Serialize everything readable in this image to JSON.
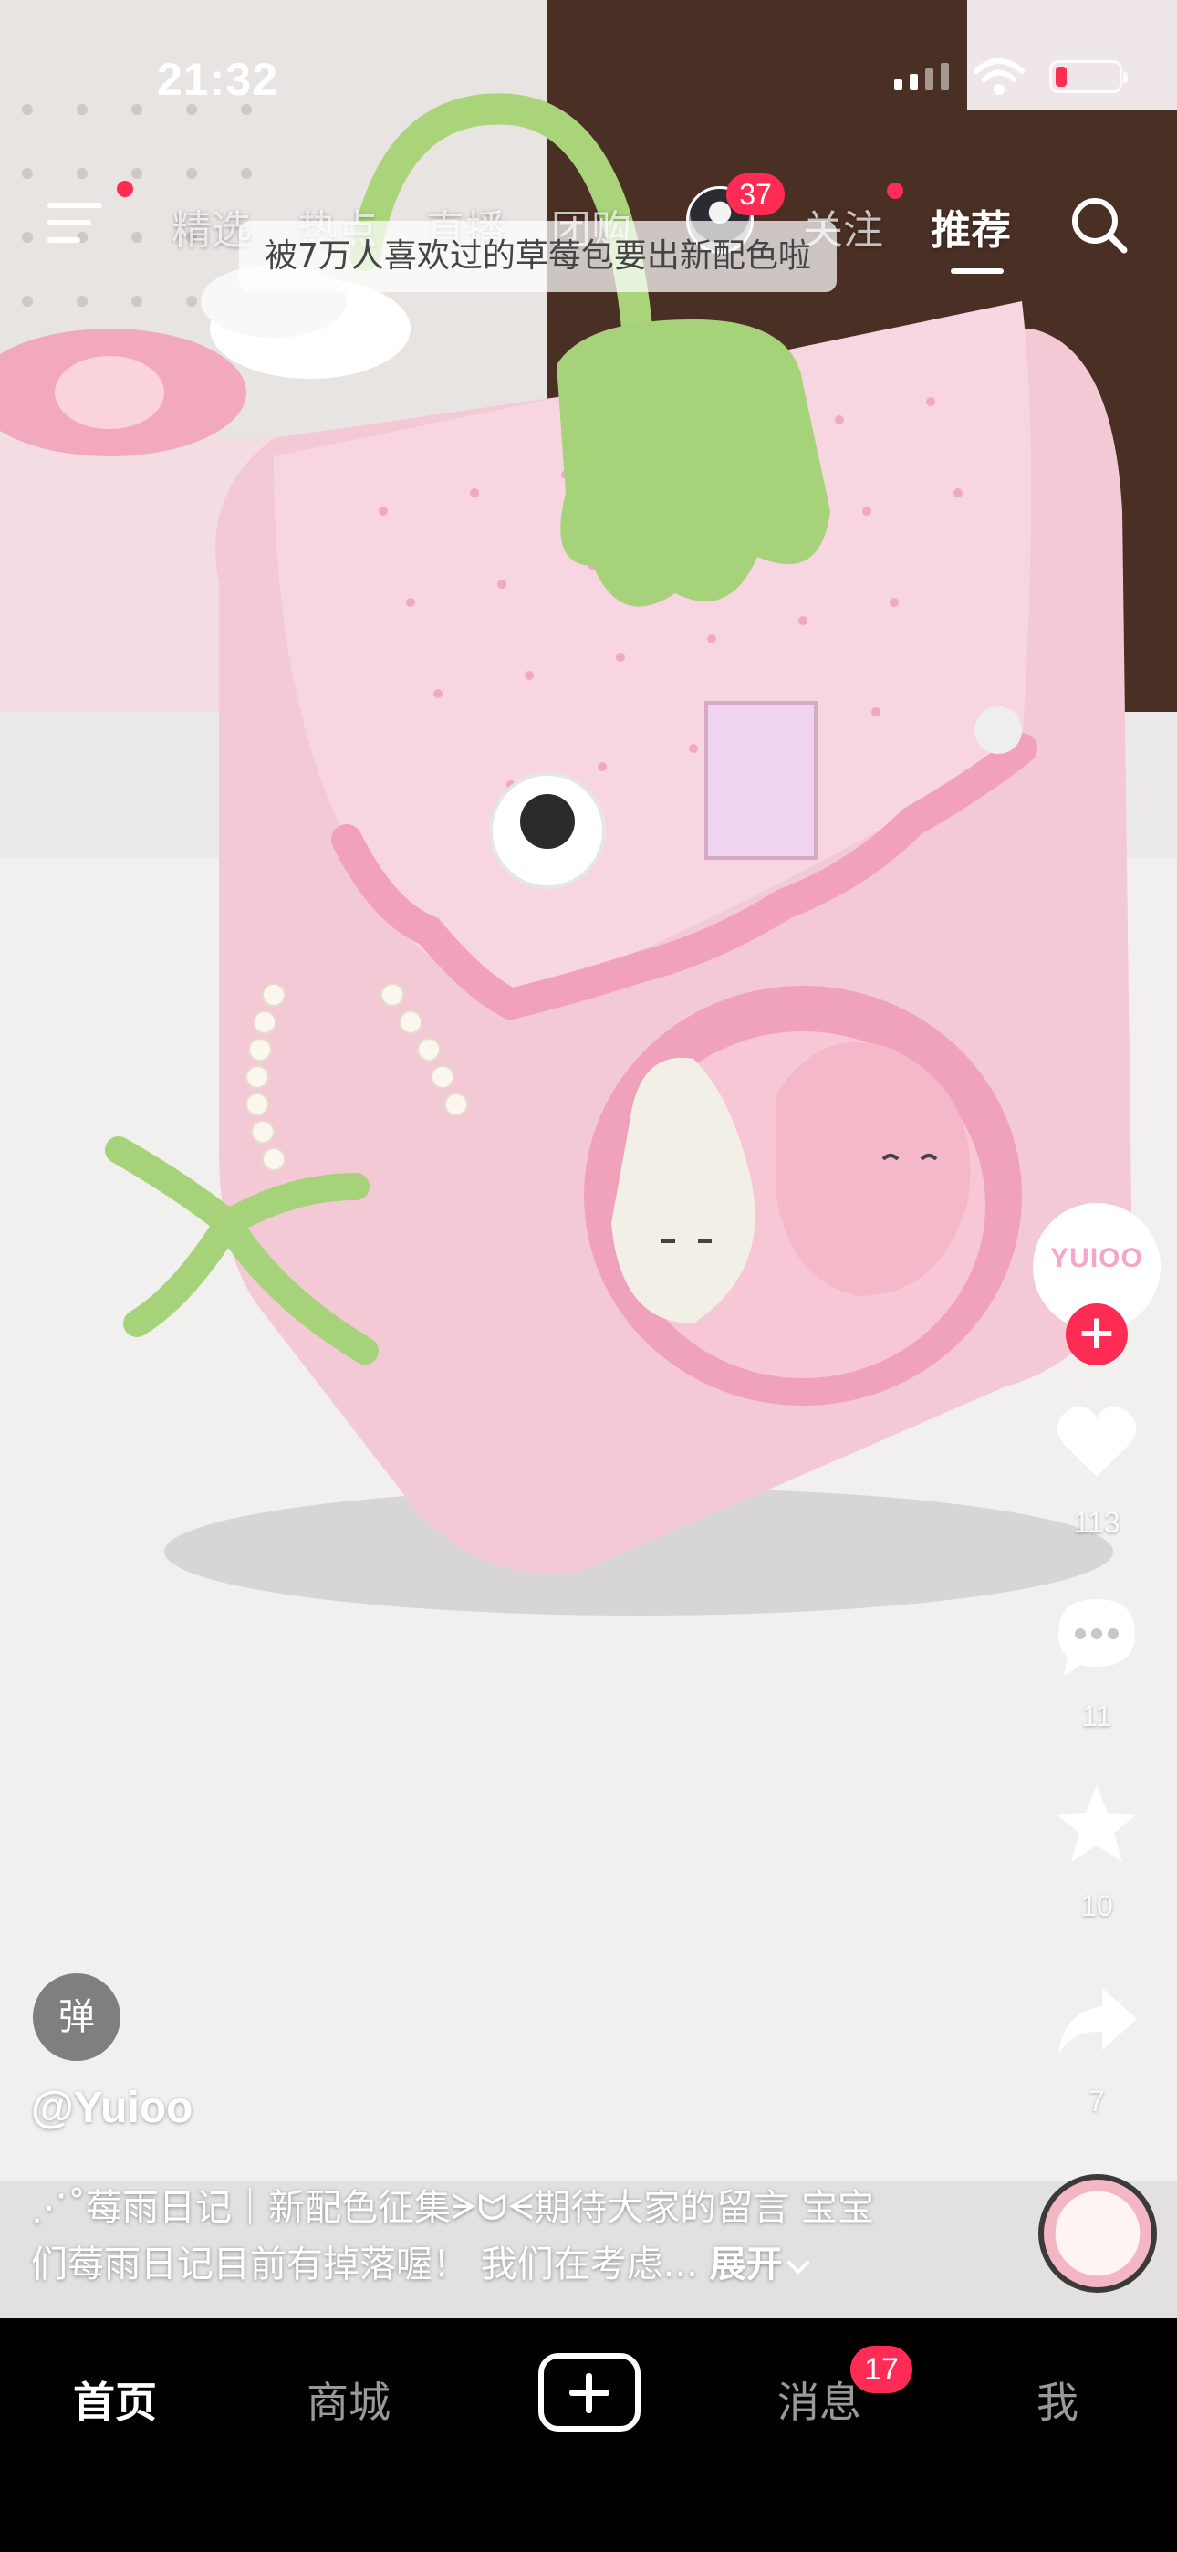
{
  "status_bar": {
    "time": "21:32",
    "battery_level": 0.18,
    "battery_color": "#ff2d4f"
  },
  "top_nav": {
    "tabs": [
      "精选",
      "热点",
      "直播",
      "团购",
      "关注",
      "推荐"
    ],
    "active_tab": "推荐",
    "live_badge_count": "37",
    "accent_color": "#fe2c55"
  },
  "video": {
    "danmaku": "被7万人喜欢过的草莓包要出新配色啦",
    "scene": "pink strawberry backpack with plush toys on a white table"
  },
  "actions": {
    "likes": "113",
    "comments": "11",
    "favorites": "10",
    "shares": "7",
    "author_avatar_text": "YUIOO"
  },
  "post": {
    "danmaku_button": "弹",
    "author": "@Yuioo",
    "caption_line1": "⋰˚莓雨日记｜新配色征集ᗒᗢᗕ期待大家的留言 宝宝",
    "caption_line2": "们莓雨日记目前有掉落喔！ 我们在考虑...",
    "expand_label": "展开"
  },
  "bottom_nav": {
    "tabs": [
      "首页",
      "商城",
      "消息",
      "我"
    ],
    "active_tab": "首页",
    "messages_badge": "17"
  }
}
